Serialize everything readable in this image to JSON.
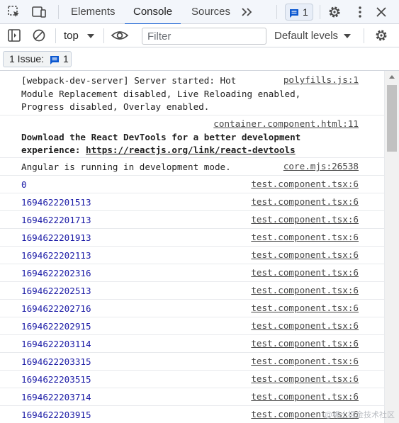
{
  "tabs": {
    "elements": "Elements",
    "console": "Console",
    "sources": "Sources",
    "issues_count": "1"
  },
  "icons": {
    "inspect": "inspect-element-icon",
    "device": "device-toolbar-icon",
    "more_tabs": "double-chevron-icon",
    "settings": "gear-icon",
    "menu": "kebab-menu-icon",
    "close": "close-icon",
    "sidebar": "sidebar-toggle-icon",
    "clear": "clear-console-icon",
    "eye": "eye-icon",
    "message": "message-icon"
  },
  "toolbar": {
    "context": "top",
    "filter_placeholder": "Filter",
    "levels": "Default levels"
  },
  "issues_bar": {
    "label": "1 Issue:",
    "count": "1"
  },
  "messages": {
    "m1": {
      "source": "polyfills.js:1",
      "line1": "[webpack-dev-server] Server started: Hot",
      "line2": "Module Replacement disabled, Live Reloading enabled,",
      "line3": "Progress disabled, Overlay enabled."
    },
    "m2": {
      "source": "container.component.html:11",
      "line1": "Download the React DevTools for a better development",
      "line2_prefix": "experience: ",
      "link": "https://reactjs.org/link/react-devtools"
    },
    "m3": {
      "source": "core.mjs:26538",
      "text": "Angular is running in development mode."
    },
    "logs": [
      {
        "value": "0",
        "source": "test.component.tsx:6"
      },
      {
        "value": "1694622201513",
        "source": "test.component.tsx:6"
      },
      {
        "value": "1694622201713",
        "source": "test.component.tsx:6"
      },
      {
        "value": "1694622201913",
        "source": "test.component.tsx:6"
      },
      {
        "value": "1694622202113",
        "source": "test.component.tsx:6"
      },
      {
        "value": "1694622202316",
        "source": "test.component.tsx:6"
      },
      {
        "value": "1694622202513",
        "source": "test.component.tsx:6"
      },
      {
        "value": "1694622202716",
        "source": "test.component.tsx:6"
      },
      {
        "value": "1694622202915",
        "source": "test.component.tsx:6"
      },
      {
        "value": "1694622203114",
        "source": "test.component.tsx:6"
      },
      {
        "value": "1694622203315",
        "source": "test.component.tsx:6"
      },
      {
        "value": "1694622203515",
        "source": "test.component.tsx:6"
      },
      {
        "value": "1694622203714",
        "source": "test.component.tsx:6"
      },
      {
        "value": "1694622203915",
        "source": "test.component.tsx:6"
      }
    ]
  },
  "watermark": "@稀土掘金技术社区",
  "colors": {
    "accent": "#0b57d0",
    "number": "#1a1aa6",
    "panel_bg": "#f3f6fb"
  }
}
